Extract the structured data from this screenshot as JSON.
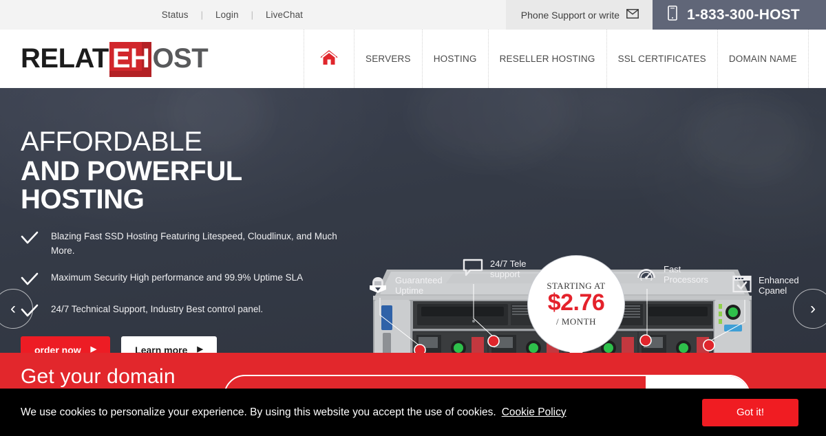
{
  "topbar": {
    "links": [
      "Status",
      "Login",
      "LiveChat"
    ],
    "separator": "|",
    "phone_support_label": "Phone Support or write",
    "envelope_icon": "envelope-icon",
    "mobile_icon": "mobile-phone-icon",
    "phone_number": "1-833-300-HOST"
  },
  "header": {
    "logo": {
      "part1": "RELAT",
      "boxed": "EH",
      "part3": "OST"
    },
    "home_icon": "home-icon",
    "nav": [
      {
        "label": "SERVERS"
      },
      {
        "label": "HOSTING"
      },
      {
        "label": "RESELLER HOSTING"
      },
      {
        "label": "SSL CERTIFICATES"
      },
      {
        "label": "DOMAIN NAME"
      }
    ]
  },
  "hero": {
    "headline_line1": "AFFORDABLE",
    "headline_line2": "AND POWERFUL HOSTING",
    "bullets": [
      "Blazing Fast SSD Hosting Featuring Litespeed, Cloudlinux, and Much More.",
      "Maximum Security High performance and 99.9% Uptime SLA",
      "24/7 Technical Support, Industry Best control panel."
    ],
    "check_icon": "check-icon",
    "buttons": {
      "order": "order now",
      "learn": "Learn more",
      "arrow": "▶"
    },
    "carousel": {
      "prev": "‹",
      "next": "›"
    },
    "price": {
      "top_label": "STARTING AT",
      "amount": "$2.76",
      "period": "/ MONTH"
    },
    "callouts": [
      {
        "icon": "shield-badge-icon",
        "line1": "Guaranteed",
        "line2": "Uptime"
      },
      {
        "icon": "chat-bubble-icon",
        "line1": "24/7 Tele",
        "line2": "support"
      },
      {
        "icon": "speedometer-icon",
        "line1": "Fast",
        "line2": "Processors"
      },
      {
        "icon": "browser-check-icon",
        "line1": "Enhanced",
        "line2": "Cpanel"
      }
    ],
    "server_image_alt": "rack-mount-server"
  },
  "domain": {
    "title": "Get your domain",
    "input_value": "",
    "input_placeholder": "",
    "button_label": ""
  },
  "cookie": {
    "message": "We use cookies to personalize your experience. By using this website you accept the use of cookies.",
    "policy_link": "Cookie Policy",
    "accept_label": "Got it!"
  },
  "colors": {
    "brand_red": "#e2272c",
    "cta_red": "#ed1c24",
    "hero_dark": "#343a46",
    "phone_block": "#606678",
    "topbar_bg": "#f3f3f3"
  }
}
